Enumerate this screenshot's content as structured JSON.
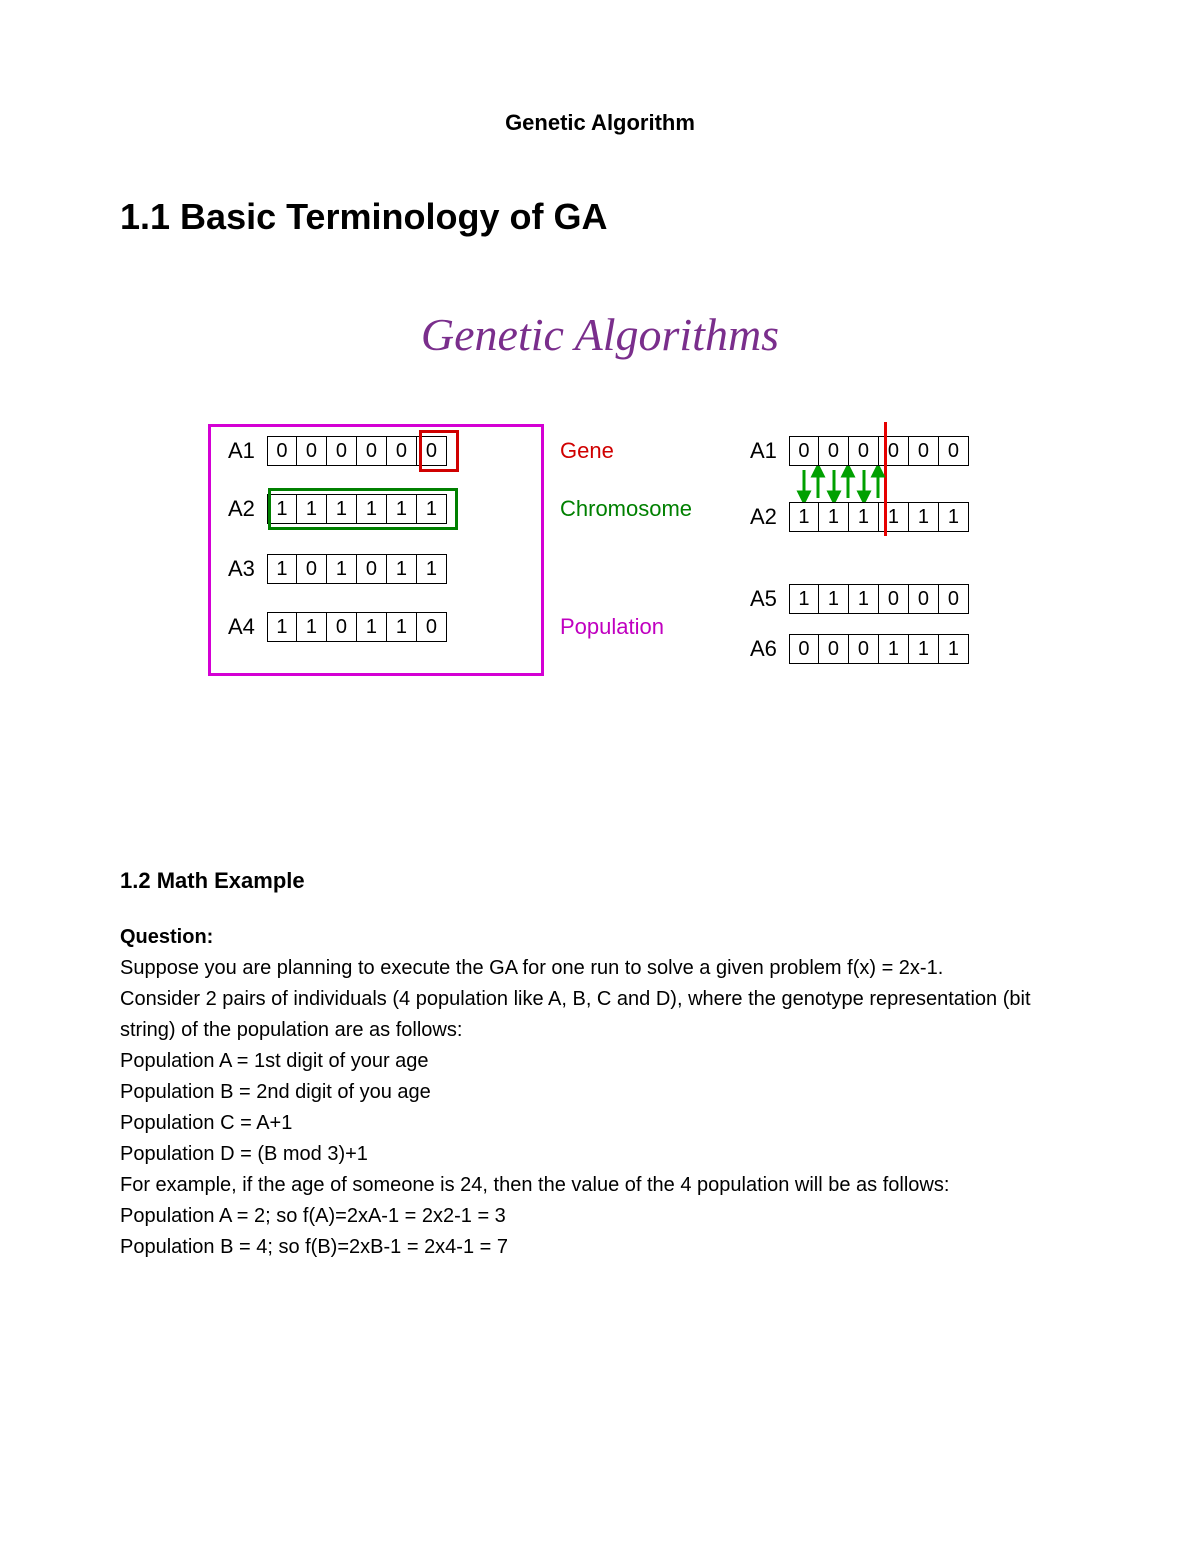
{
  "doc": {
    "title": "Genetic Algorithm",
    "section_heading": "1.1 Basic Terminology of GA"
  },
  "figure": {
    "title": "Genetic Algorithms",
    "labels": {
      "gene": "Gene",
      "chromosome": "Chromosome",
      "population": "Population"
    },
    "left": {
      "rows": [
        {
          "name": "A1",
          "cells": [
            "0",
            "0",
            "0",
            "0",
            "0",
            "0"
          ]
        },
        {
          "name": "A2",
          "cells": [
            "1",
            "1",
            "1",
            "1",
            "1",
            "1"
          ]
        },
        {
          "name": "A3",
          "cells": [
            "1",
            "0",
            "1",
            "0",
            "1",
            "1"
          ]
        },
        {
          "name": "A4",
          "cells": [
            "1",
            "1",
            "0",
            "1",
            "1",
            "0"
          ]
        }
      ]
    },
    "right": {
      "rows": [
        {
          "name": "A1",
          "cells": [
            "0",
            "0",
            "0",
            "0",
            "0",
            "0"
          ]
        },
        {
          "name": "A2",
          "cells": [
            "1",
            "1",
            "1",
            "1",
            "1",
            "1"
          ]
        },
        {
          "name": "A5",
          "cells": [
            "1",
            "1",
            "1",
            "0",
            "0",
            "0"
          ]
        },
        {
          "name": "A6",
          "cells": [
            "0",
            "0",
            "0",
            "1",
            "1",
            "1"
          ]
        }
      ]
    }
  },
  "section2": {
    "heading": "1.2 Math Example",
    "question_label": "Question:",
    "lines": [
      "Suppose you are planning to execute the GA for one run to solve a given problem f(x) = 2x-1.",
      "Consider 2 pairs of individuals (4 population like A, B, C and D), where the genotype representation (bit string) of the population are as follows:",
      "Population A = 1st digit of your age",
      "Population B = 2nd digit of you age",
      "Population C = A+1",
      "Population D = (B mod 3)+1",
      "For example, if the age of someone is 24, then the value of the 4 population will be as follows:",
      "Population A = 2; so f(A)=2xA-1 = 2x2-1 = 3",
      "Population B = 4; so f(B)=2xB-1 = 2x4-1 = 7"
    ]
  }
}
